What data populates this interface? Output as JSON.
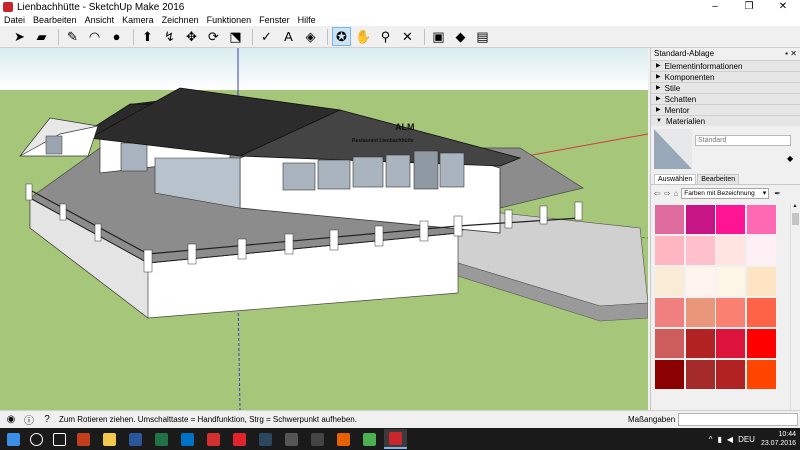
{
  "window": {
    "title": "Lienbachhütte - SketchUp Make 2016",
    "buttons": [
      "–",
      "❐",
      "✕"
    ]
  },
  "menu": [
    "Datei",
    "Bearbeiten",
    "Ansicht",
    "Kamera",
    "Zeichnen",
    "Funktionen",
    "Fenster",
    "Hilfe"
  ],
  "toolbar": {
    "groups": [
      [
        "select-arrow-icon",
        "eraser-icon"
      ],
      [
        "pencil-icon",
        "arc-icon",
        "shape-circle-icon"
      ],
      [
        "push-pull-icon",
        "follow-me-icon",
        "move-icon",
        "rotate-icon",
        "scale-icon"
      ],
      [
        "tape-measure-icon",
        "text-icon",
        "paint-bucket-icon"
      ],
      [
        "orbit-icon",
        "pan-icon",
        "zoom-icon",
        "zoom-extents-icon"
      ],
      [
        "warehouse-icon",
        "extension-icon",
        "layout-icon"
      ]
    ],
    "glyphs": {
      "select-arrow-icon": "➤",
      "eraser-icon": "▰",
      "pencil-icon": "✎",
      "arc-icon": "◠",
      "shape-circle-icon": "●",
      "push-pull-icon": "⬆",
      "follow-me-icon": "↯",
      "move-icon": "✥",
      "rotate-icon": "⟳",
      "scale-icon": "⬔",
      "tape-measure-icon": "✓",
      "text-icon": "A",
      "paint-bucket-icon": "◈",
      "orbit-icon": "✪",
      "pan-icon": "✋",
      "zoom-icon": "⚲",
      "zoom-extents-icon": "✕",
      "warehouse-icon": "▣",
      "extension-icon": "◆",
      "layout-icon": "▤"
    },
    "active": "orbit-icon"
  },
  "model": {
    "sign_line1": "ALM",
    "sign_line2": "Restaurant Lienbachhütte"
  },
  "tray": {
    "title": "Standard-Ablage",
    "pin": "▪",
    "close": "✕",
    "sections": [
      {
        "label": "Elementinformationen",
        "expanded": false
      },
      {
        "label": "Komponenten",
        "expanded": false
      },
      {
        "label": "Stile",
        "expanded": false
      },
      {
        "label": "Schatten",
        "expanded": false
      },
      {
        "label": "Mentor",
        "expanded": false
      },
      {
        "label": "Materialien",
        "expanded": true
      }
    ],
    "material_name": "Standard",
    "tabs": [
      "Auswählen",
      "Bearbeiten"
    ],
    "selected_tab": "Auswählen",
    "nav_icons": [
      "arrow-left-icon",
      "arrow-right-icon",
      "home-icon"
    ],
    "collection": "Farben mit Bezeichnung",
    "swatches": [
      [
        "#e06c9f",
        "#c71585",
        "#ff1493",
        "#ff69b4"
      ],
      [
        "#ffb6c1",
        "#ffc0cb",
        "#ffe4e1",
        "#fff0f5"
      ],
      [
        "#faebd7",
        "#fff5ee",
        "#fdf5e6",
        "#ffe4c4"
      ],
      [
        "#f08080",
        "#e9967a",
        "#fa8072",
        "#ff6347"
      ],
      [
        "#cd5c5c",
        "#b22222",
        "#dc143c",
        "#ff0000"
      ],
      [
        "#8b0000",
        "#a52a2a",
        "#b22222",
        "#ff4500"
      ]
    ]
  },
  "status": {
    "message": "Zum Rotieren ziehen. Umschalttaste = Handfunktion, Strg = Schwerpunkt aufheben.",
    "measurements_label": "Maßangaben",
    "icons": [
      "geo-location-icon",
      "credits-icon",
      "info-icon"
    ]
  },
  "taskbar": {
    "apps": [
      {
        "name": "windows-start-icon",
        "color": "#3a8ee6"
      },
      {
        "name": "search-icon",
        "color": "#ffffff"
      },
      {
        "name": "task-view-icon",
        "color": "#ffffff"
      },
      {
        "name": "powerpoint-icon",
        "color": "#c43e1c"
      },
      {
        "name": "explorer-icon",
        "color": "#f2c94c"
      },
      {
        "name": "word-icon",
        "color": "#2b579a"
      },
      {
        "name": "excel-icon",
        "color": "#217346"
      },
      {
        "name": "outlook-icon",
        "color": "#0072c6"
      },
      {
        "name": "acrobat-icon",
        "color": "#d32f2f"
      },
      {
        "name": "opera-icon",
        "color": "#e0232d"
      },
      {
        "name": "steam-icon",
        "color": "#2a475e"
      },
      {
        "name": "game-icon",
        "color": "#555555"
      },
      {
        "name": "alienware-icon",
        "color": "#444444"
      },
      {
        "name": "firefox-icon",
        "color": "#e66000"
      },
      {
        "name": "chrome-icon",
        "color": "#4caf50"
      },
      {
        "name": "sketchup-icon",
        "color": "#c8262c"
      }
    ],
    "active": "sketchup-icon",
    "language": "DEU",
    "time": "10:44",
    "date": "23.07.2016"
  }
}
